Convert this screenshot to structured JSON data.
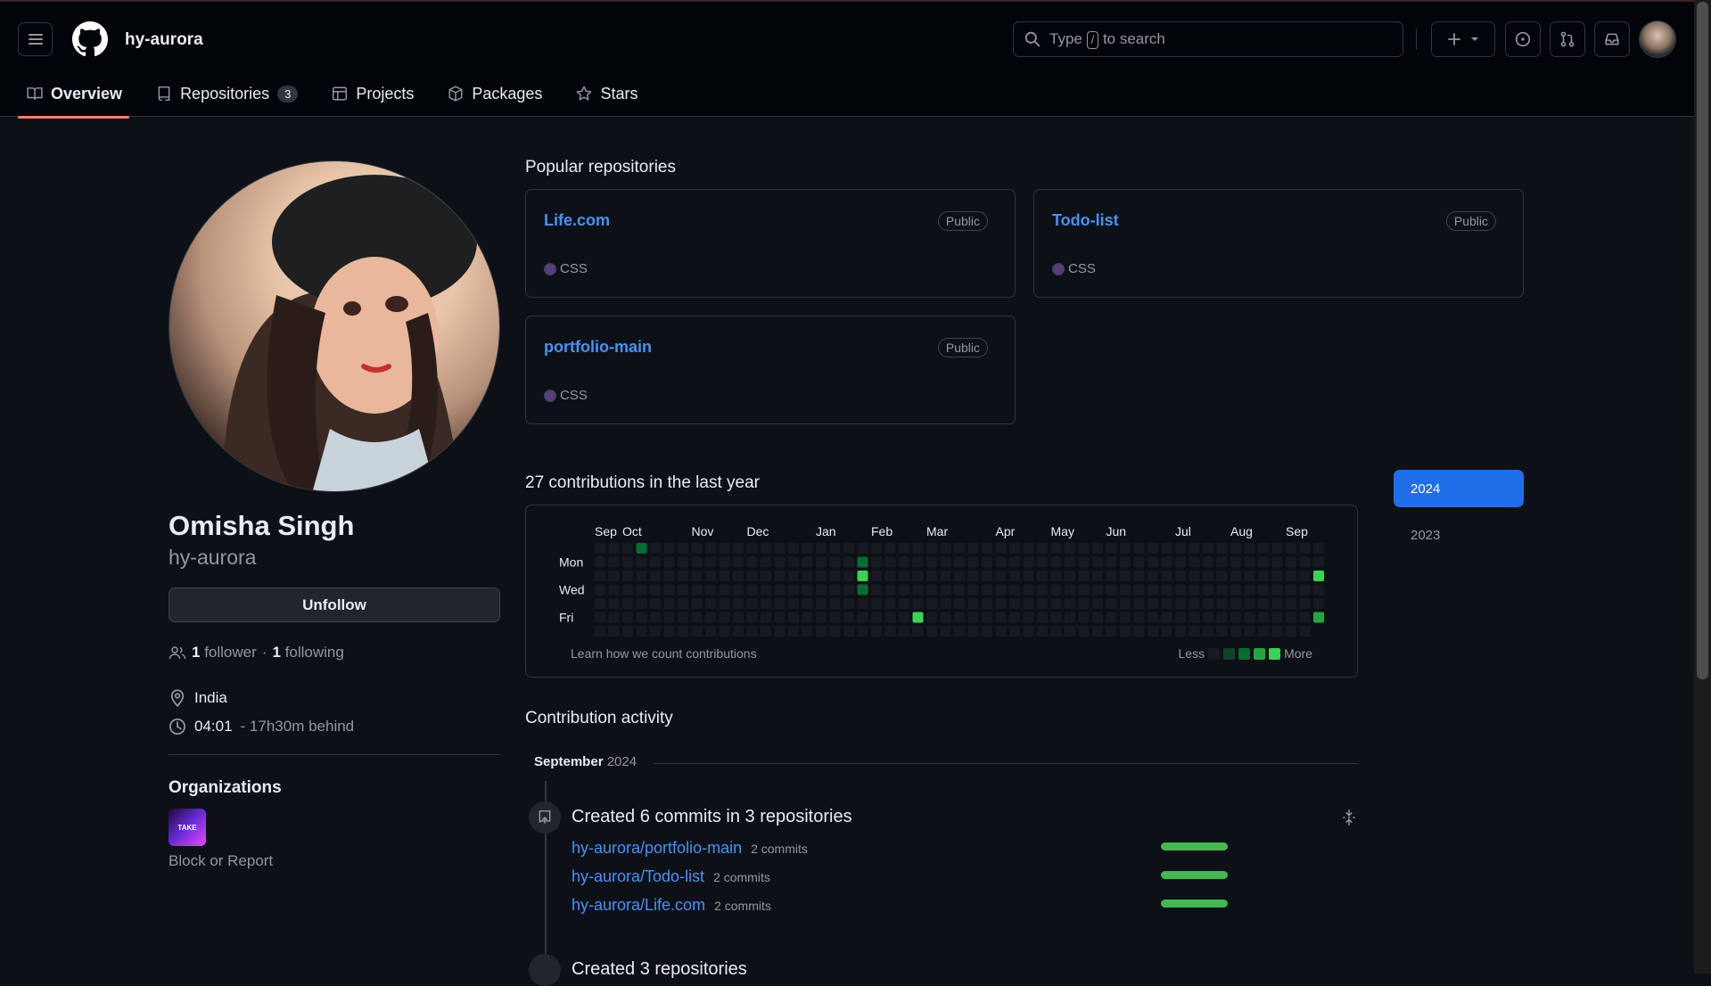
{
  "header": {
    "username": "hy-aurora",
    "search_prefix": "Type",
    "search_slash": "/",
    "search_suffix": "to search"
  },
  "tabs": [
    {
      "label": "Overview",
      "icon": "book-icon"
    },
    {
      "label": "Repositories",
      "icon": "repo-icon",
      "count": "3"
    },
    {
      "label": "Projects",
      "icon": "table-icon"
    },
    {
      "label": "Packages",
      "icon": "package-icon"
    },
    {
      "label": "Stars",
      "icon": "star-icon"
    }
  ],
  "profile": {
    "name": "Omisha Singh",
    "login": "hy-aurora",
    "unfollow_label": "Unfollow",
    "followers_count": "1",
    "followers_label": "follower",
    "separator": "·",
    "following_count": "1",
    "following_label": "following",
    "location": "India",
    "time": "04:01",
    "time_note": "- 17h30m behind",
    "orgs_title": "Organizations",
    "org_avatar_text": "TAKE",
    "block_label": "Block or Report"
  },
  "popular": {
    "title": "Popular repositories",
    "repos": [
      {
        "name": "Life.com",
        "visibility": "Public",
        "language": "CSS",
        "lang_color": "#563d7c"
      },
      {
        "name": "Todo-list",
        "visibility": "Public",
        "language": "CSS",
        "lang_color": "#563d7c"
      },
      {
        "name": "portfolio-main",
        "visibility": "Public",
        "language": "CSS",
        "lang_color": "#563d7c"
      }
    ]
  },
  "contributions": {
    "title": "27 contributions in the last year",
    "months": [
      "Sep",
      "Oct",
      "Nov",
      "Dec",
      "Jan",
      "Feb",
      "Mar",
      "Apr",
      "May",
      "Jun",
      "Jul",
      "Aug",
      "Sep"
    ],
    "days": [
      "Mon",
      "Wed",
      "Fri"
    ],
    "learn_label": "Learn how we count contributions",
    "less_label": "Less",
    "more_label": "More",
    "active_cells": [
      {
        "week": 3,
        "day": 0,
        "level": 2
      },
      {
        "week": 19,
        "day": 1,
        "level": 2
      },
      {
        "week": 19,
        "day": 2,
        "level": 4
      },
      {
        "week": 19,
        "day": 3,
        "level": 2
      },
      {
        "week": 23,
        "day": 5,
        "level": 4
      },
      {
        "week": 52,
        "day": 2,
        "level": 4
      },
      {
        "week": 52,
        "day": 5,
        "level": 3
      }
    ],
    "colors": {
      "empty": "#161b22",
      "l1": "#0e4429",
      "l2": "#006d32",
      "l3": "#26a641",
      "l4": "#39d353"
    }
  },
  "years": {
    "selected": "2024",
    "other": "2023"
  },
  "activity": {
    "title": "Contribution activity",
    "month": "September",
    "year": "2024",
    "summary": "Created 6 commits in 3 repositories",
    "commits": [
      {
        "repo": "hy-aurora/portfolio-main",
        "count": "2 commits"
      },
      {
        "repo": "hy-aurora/Todo-list",
        "count": "2 commits"
      },
      {
        "repo": "hy-aurora/Life.com",
        "count": "2 commits"
      }
    ],
    "next_summary": "Created 3 repositories"
  }
}
